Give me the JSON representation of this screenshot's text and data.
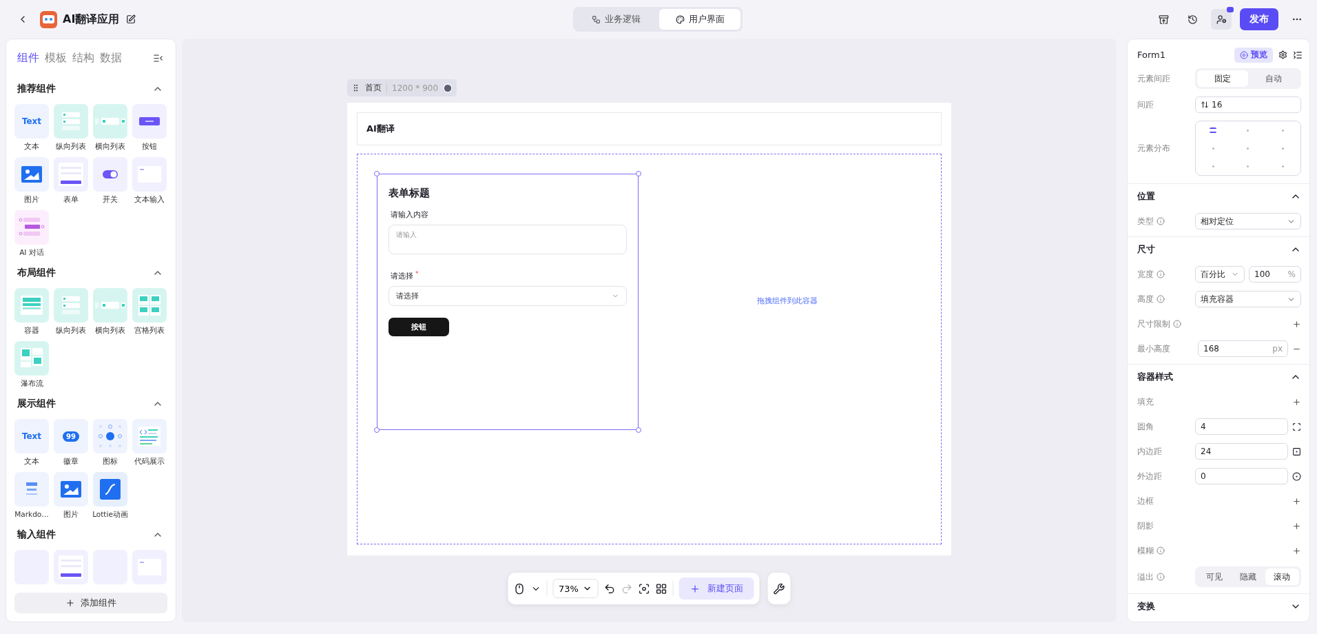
{
  "app": {
    "title": "AI翻译应用"
  },
  "mode_tabs": [
    {
      "label": "业务逻辑",
      "kind": "logic",
      "selected": false
    },
    {
      "label": "用户界面",
      "kind": "ui",
      "selected": true
    }
  ],
  "publish": "发布",
  "left_panel": {
    "tabs": [
      {
        "label": "组件",
        "selected": true
      },
      {
        "label": "模板",
        "selected": false
      },
      {
        "label": "结构",
        "selected": false
      },
      {
        "label": "数据",
        "selected": false
      }
    ],
    "sections": [
      {
        "title": "推荐组件",
        "expanded": true,
        "items": [
          {
            "label": "文本",
            "kind": "text",
            "thumb_text": "Text"
          },
          {
            "label": "纵向列表",
            "kind": "vlist"
          },
          {
            "label": "横向列表",
            "kind": "hlist"
          },
          {
            "label": "按钮",
            "kind": "button"
          },
          {
            "label": "图片",
            "kind": "image"
          },
          {
            "label": "表单",
            "kind": "form"
          },
          {
            "label": "开关",
            "kind": "switch"
          },
          {
            "label": "文本输入",
            "kind": "input"
          },
          {
            "label": "AI 对话",
            "kind": "chat"
          }
        ]
      },
      {
        "title": "布局组件",
        "expanded": true,
        "items": [
          {
            "label": "容器",
            "kind": "container"
          },
          {
            "label": "纵向列表",
            "kind": "vlist"
          },
          {
            "label": "横向列表",
            "kind": "hlist"
          },
          {
            "label": "宫格列表",
            "kind": "grid"
          },
          {
            "label": "瀑布流",
            "kind": "waterfall"
          }
        ]
      },
      {
        "title": "展示组件",
        "expanded": true,
        "items": [
          {
            "label": "文本",
            "kind": "text",
            "thumb_text": "Text"
          },
          {
            "label": "徽章",
            "kind": "badge",
            "thumb_text": "99"
          },
          {
            "label": "图标",
            "kind": "icons"
          },
          {
            "label": "代码展示",
            "kind": "code"
          },
          {
            "label": "Markdo…",
            "kind": "markdown"
          },
          {
            "label": "图片",
            "kind": "image"
          },
          {
            "label": "Lottie动画",
            "kind": "lottie"
          }
        ]
      },
      {
        "title": "输入组件",
        "expanded": true,
        "items": [
          {
            "kind": "blank"
          },
          {
            "kind": "form"
          },
          {
            "kind": "blank"
          },
          {
            "kind": "input"
          }
        ]
      }
    ],
    "add_button": "添加组件"
  },
  "canvas": {
    "page_chip": {
      "name": "首页",
      "size": "1200 * 900"
    },
    "header": "AI翻译",
    "form": {
      "title": "表单标题",
      "fields": [
        {
          "kind": "textarea",
          "label": "请输入内容",
          "placeholder": "请输入"
        },
        {
          "kind": "select",
          "label": "请选择",
          "placeholder": "请选择",
          "mark": "*"
        }
      ],
      "button": "按钮"
    },
    "drop_hint": "拖拽组件到此容器"
  },
  "toolbar": {
    "zoom": "73%",
    "new_page": "新建页面"
  },
  "inspector": {
    "title": "Form1",
    "preview": "预览",
    "rows": [
      {
        "kind": "segmented",
        "label": "元素间距",
        "options": [
          {
            "label": "固定",
            "selected": true
          },
          {
            "label": "自动",
            "selected": false
          }
        ]
      },
      {
        "kind": "spacing",
        "label": "间距",
        "value": "16"
      },
      {
        "kind": "align",
        "label": "元素分布",
        "cells": [
          {
            "selected": true
          },
          {
            "selected": false
          },
          {
            "selected": false
          },
          {
            "selected": false
          },
          {
            "selected": false
          },
          {
            "selected": false
          },
          {
            "selected": false
          },
          {
            "selected": false
          },
          {
            "selected": false
          }
        ]
      }
    ],
    "sections": [
      {
        "title": "位置",
        "expanded": true,
        "rows": [
          {
            "kind": "select",
            "label": "类型",
            "info": true,
            "value": "相对定位"
          }
        ]
      },
      {
        "title": "尺寸",
        "expanded": true,
        "rows": [
          {
            "kind": "select_input",
            "label": "宽度",
            "info": true,
            "value": "百分比",
            "input": "100",
            "unit": "%"
          },
          {
            "kind": "select",
            "label": "高度",
            "info": true,
            "value": "填充容器"
          },
          {
            "kind": "add",
            "label": "尺寸限制",
            "info": true
          },
          {
            "kind": "input_remove",
            "label": "最小高度",
            "value": "168",
            "unit": "px"
          }
        ]
      },
      {
        "title": "容器样式",
        "expanded": true,
        "rows": [
          {
            "kind": "add",
            "label": "填充"
          },
          {
            "kind": "radius",
            "label": "圆角",
            "value": "4"
          },
          {
            "kind": "padding",
            "label": "内边距",
            "value": "24"
          },
          {
            "kind": "margin",
            "label": "外边距",
            "value": "0"
          },
          {
            "kind": "add",
            "label": "边框"
          },
          {
            "kind": "add",
            "label": "阴影"
          },
          {
            "kind": "add",
            "label": "模糊",
            "info": true
          },
          {
            "kind": "segmented",
            "label": "溢出",
            "info": true,
            "options": [
              {
                "label": "可见",
                "selected": false
              },
              {
                "label": "隐藏",
                "selected": false
              },
              {
                "label": "滚动",
                "selected": true
              }
            ]
          }
        ]
      },
      {
        "title": "变换",
        "expanded": false
      }
    ]
  }
}
